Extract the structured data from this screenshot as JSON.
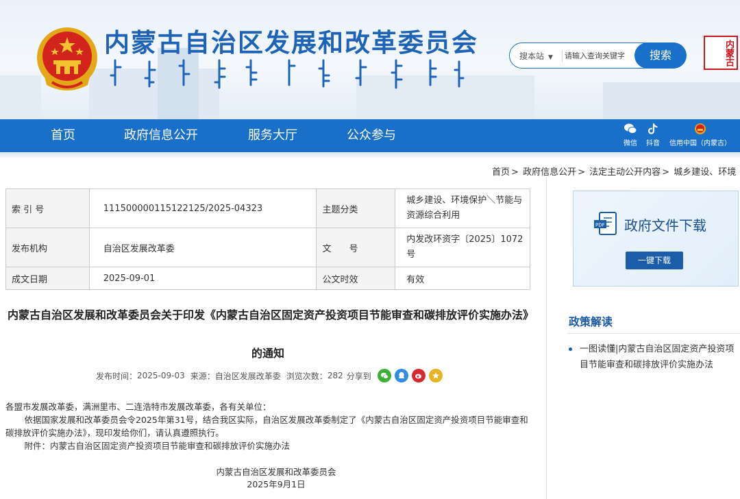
{
  "header": {
    "site_title": "内蒙古自治区发展和改革委员会",
    "search": {
      "scope": "搜本站",
      "placeholder": "请输入查询关键字",
      "button": "搜索"
    },
    "seal_text": "内蒙古"
  },
  "nav": {
    "items": [
      "首页",
      "政府信息公开",
      "服务大厅",
      "公众参与"
    ],
    "tools": [
      {
        "label": "微信",
        "icon": "wechat-icon"
      },
      {
        "label": "抖音",
        "icon": "douyin-icon"
      },
      {
        "label": "信用中国（内蒙古）",
        "icon": "credit-china-icon"
      }
    ]
  },
  "breadcrumb": [
    "首页",
    "政府信息公开",
    "法定主动公开内容",
    "城乡建设、环境"
  ],
  "meta": {
    "index_label": "索 引 号",
    "index_value": "111500000115122125/2025-04323",
    "topic_label": "主题分类",
    "topic_value": "城乡建设、环境保护＼节能与资源综合利用",
    "org_label": "发布机构",
    "org_value": "自治区发展改革委",
    "doc_label": "文　　号",
    "doc_value": "内发改环资字〔2025〕1072号",
    "date_label": "成文日期",
    "date_value": "2025-09-01",
    "valid_label": "公文时效",
    "valid_value": "有效"
  },
  "article": {
    "title": "内蒙古自治区发展和改革委员会关于印发《内蒙古自治区固定资产投资项目节能审查和碳排放评价实施办法》的通知",
    "publish_label": "发布时间：",
    "publish_time": "2025-09-03",
    "source_label": "来源：",
    "source": "自治区发展改革委",
    "views_label": "浏览次数：",
    "views": "282",
    "share_label": "分享到",
    "share_colors": {
      "wechat": "#3cb035",
      "qq": "#2f8de4",
      "weibo": "#d52b2f",
      "qzone": "#e6b422"
    },
    "salutation": "各盟市发展改革委，满洲里市、二连浩特市发展改革委，各有关单位：",
    "paragraph": "依据国家发展和改革委员会令2025年第31号，结合我区实际，自治区发展改革委制定了《内蒙古自治区固定资产投资项目节能审查和碳排放评价实施办法》，现印发给你们，请认真遵照执行。",
    "attachment": "附件：内蒙古自治区固定资产投资项目节能审查和碳排放评价实施办法",
    "sign_org": "内蒙古自治区发展和改革委员会",
    "sign_date": "2025年9月1日"
  },
  "sidebar": {
    "download_title": "政府文件下载",
    "download_button": "一键下载",
    "policy_heading": "政策解读",
    "policy_items": [
      "一图读懂|内蒙古自治区固定资产投资项目节能审查和碳排放评价实施办法"
    ]
  },
  "colors": {
    "brand_blue": "#1a6fc9",
    "title_blue": "#1f63b6",
    "seal_red": "#c8161d"
  }
}
